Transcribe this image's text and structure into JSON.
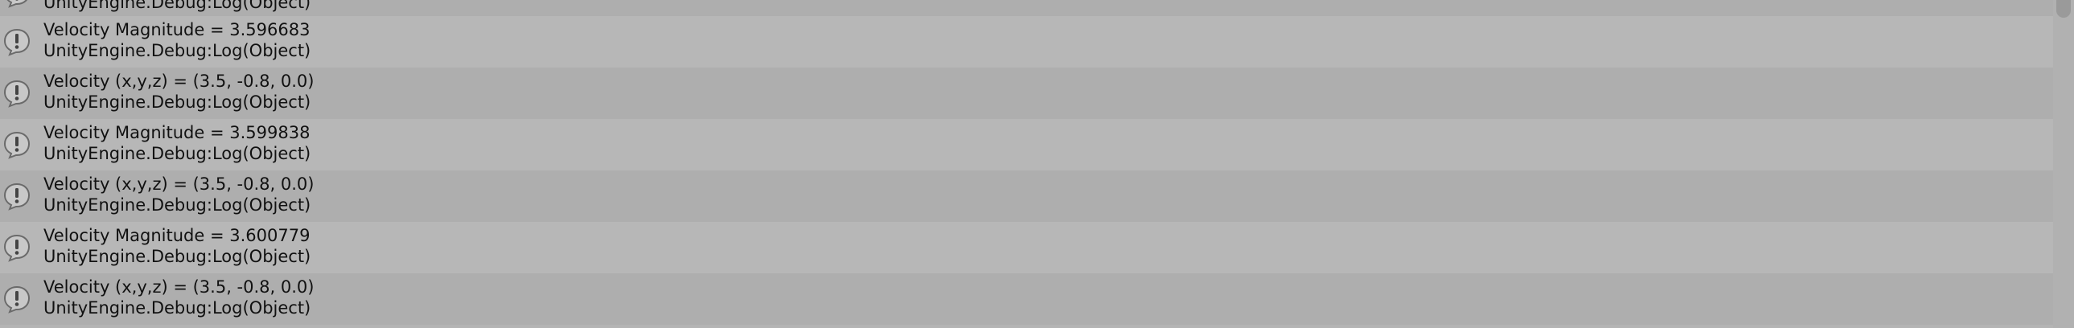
{
  "console": {
    "partial_top_text": "UnityEngine.Debug:Log(Object)",
    "entries": [
      {
        "line1": "Velocity Magnitude = 3.596683",
        "line2": "UnityEngine.Debug:Log(Object)"
      },
      {
        "line1": "Velocity (x,y,z) = (3.5, -0.8, 0.0)",
        "line2": "UnityEngine.Debug:Log(Object)"
      },
      {
        "line1": "Velocity Magnitude = 3.599838",
        "line2": "UnityEngine.Debug:Log(Object)"
      },
      {
        "line1": "Velocity (x,y,z) = (3.5, -0.8, 0.0)",
        "line2": "UnityEngine.Debug:Log(Object)"
      },
      {
        "line1": "Velocity Magnitude = 3.600779",
        "line2": "UnityEngine.Debug:Log(Object)"
      },
      {
        "line1": "Velocity (x,y,z) = (3.5, -0.8, 0.0)",
        "line2": "UnityEngine.Debug:Log(Object)"
      }
    ],
    "icon": "info-speech-bubble-icon"
  }
}
